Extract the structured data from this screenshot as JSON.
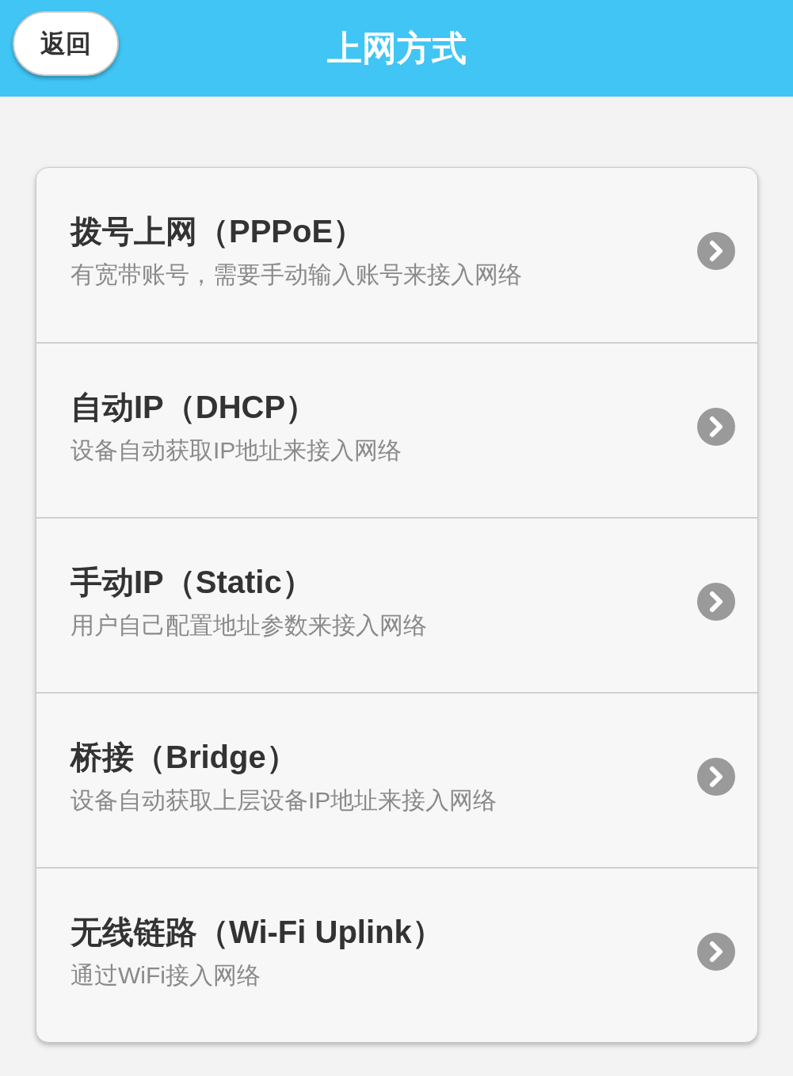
{
  "header": {
    "back_button": "返回",
    "title": "上网方式"
  },
  "options": [
    {
      "title": "拨号上网（PPPoE）",
      "description": "有宽带账号，需要手动输入账号来接入网络"
    },
    {
      "title": "自动IP（DHCP）",
      "description": "设备自动获取IP地址来接入网络"
    },
    {
      "title": "手动IP（Static）",
      "description": "用户自己配置地址参数来接入网络"
    },
    {
      "title": "桥接（Bridge）",
      "description": "设备自动获取上层设备IP地址来接入网络"
    },
    {
      "title": "无线链路（Wi-Fi Uplink）",
      "description": "通过WiFi接入网络"
    }
  ]
}
